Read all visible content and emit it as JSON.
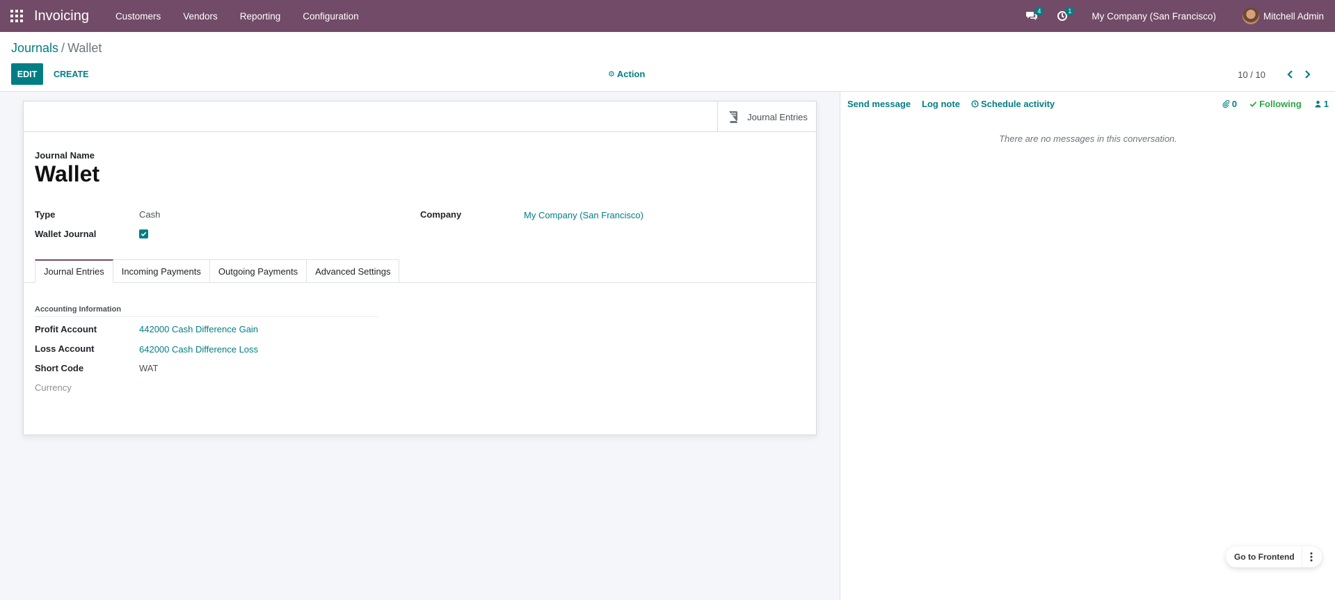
{
  "navbar": {
    "app_name": "Invoicing",
    "menu": [
      {
        "label": "Customers"
      },
      {
        "label": "Vendors"
      },
      {
        "label": "Reporting"
      },
      {
        "label": "Configuration"
      }
    ],
    "messages_badge": "4",
    "activities_badge": "1",
    "company": "My Company (San Francisco)",
    "user": "Mitchell Admin"
  },
  "control_panel": {
    "breadcrumb_parent": "Journals",
    "breadcrumb_separator": "/",
    "breadcrumb_current": "Wallet",
    "edit_label": "EDIT",
    "create_label": "CREATE",
    "action_label": "Action",
    "pager_value": "10 / 10"
  },
  "form": {
    "smart_button_label": "Journal Entries",
    "name_label": "Journal Name",
    "name_value": "Wallet",
    "type_label": "Type",
    "type_value": "Cash",
    "wallet_label": "Wallet Journal",
    "wallet_checked": true,
    "company_label": "Company",
    "company_value": "My Company (San Francisco)",
    "tabs": [
      {
        "label": "Journal Entries",
        "active": true
      },
      {
        "label": "Incoming Payments",
        "active": false
      },
      {
        "label": "Outgoing Payments",
        "active": false
      },
      {
        "label": "Advanced Settings",
        "active": false
      }
    ],
    "group_title": "Accounting Information",
    "profit_label": "Profit Account",
    "profit_value": "442000 Cash Difference Gain",
    "loss_label": "Loss Account",
    "loss_value": "642000 Cash Difference Loss",
    "short_code_label": "Short Code",
    "short_code_value": "WAT",
    "currency_label": "Currency"
  },
  "chatter": {
    "send_message": "Send message",
    "log_note": "Log note",
    "schedule_activity": "Schedule activity",
    "attachments_count": "0",
    "following_label": "Following",
    "followers_count": "1",
    "empty_text": "There are no messages in this conversation."
  },
  "widget": {
    "frontend_label": "Go to Frontend"
  },
  "colors": {
    "navbar": "#714b67",
    "accent": "#017e84",
    "following": "#28a745"
  }
}
